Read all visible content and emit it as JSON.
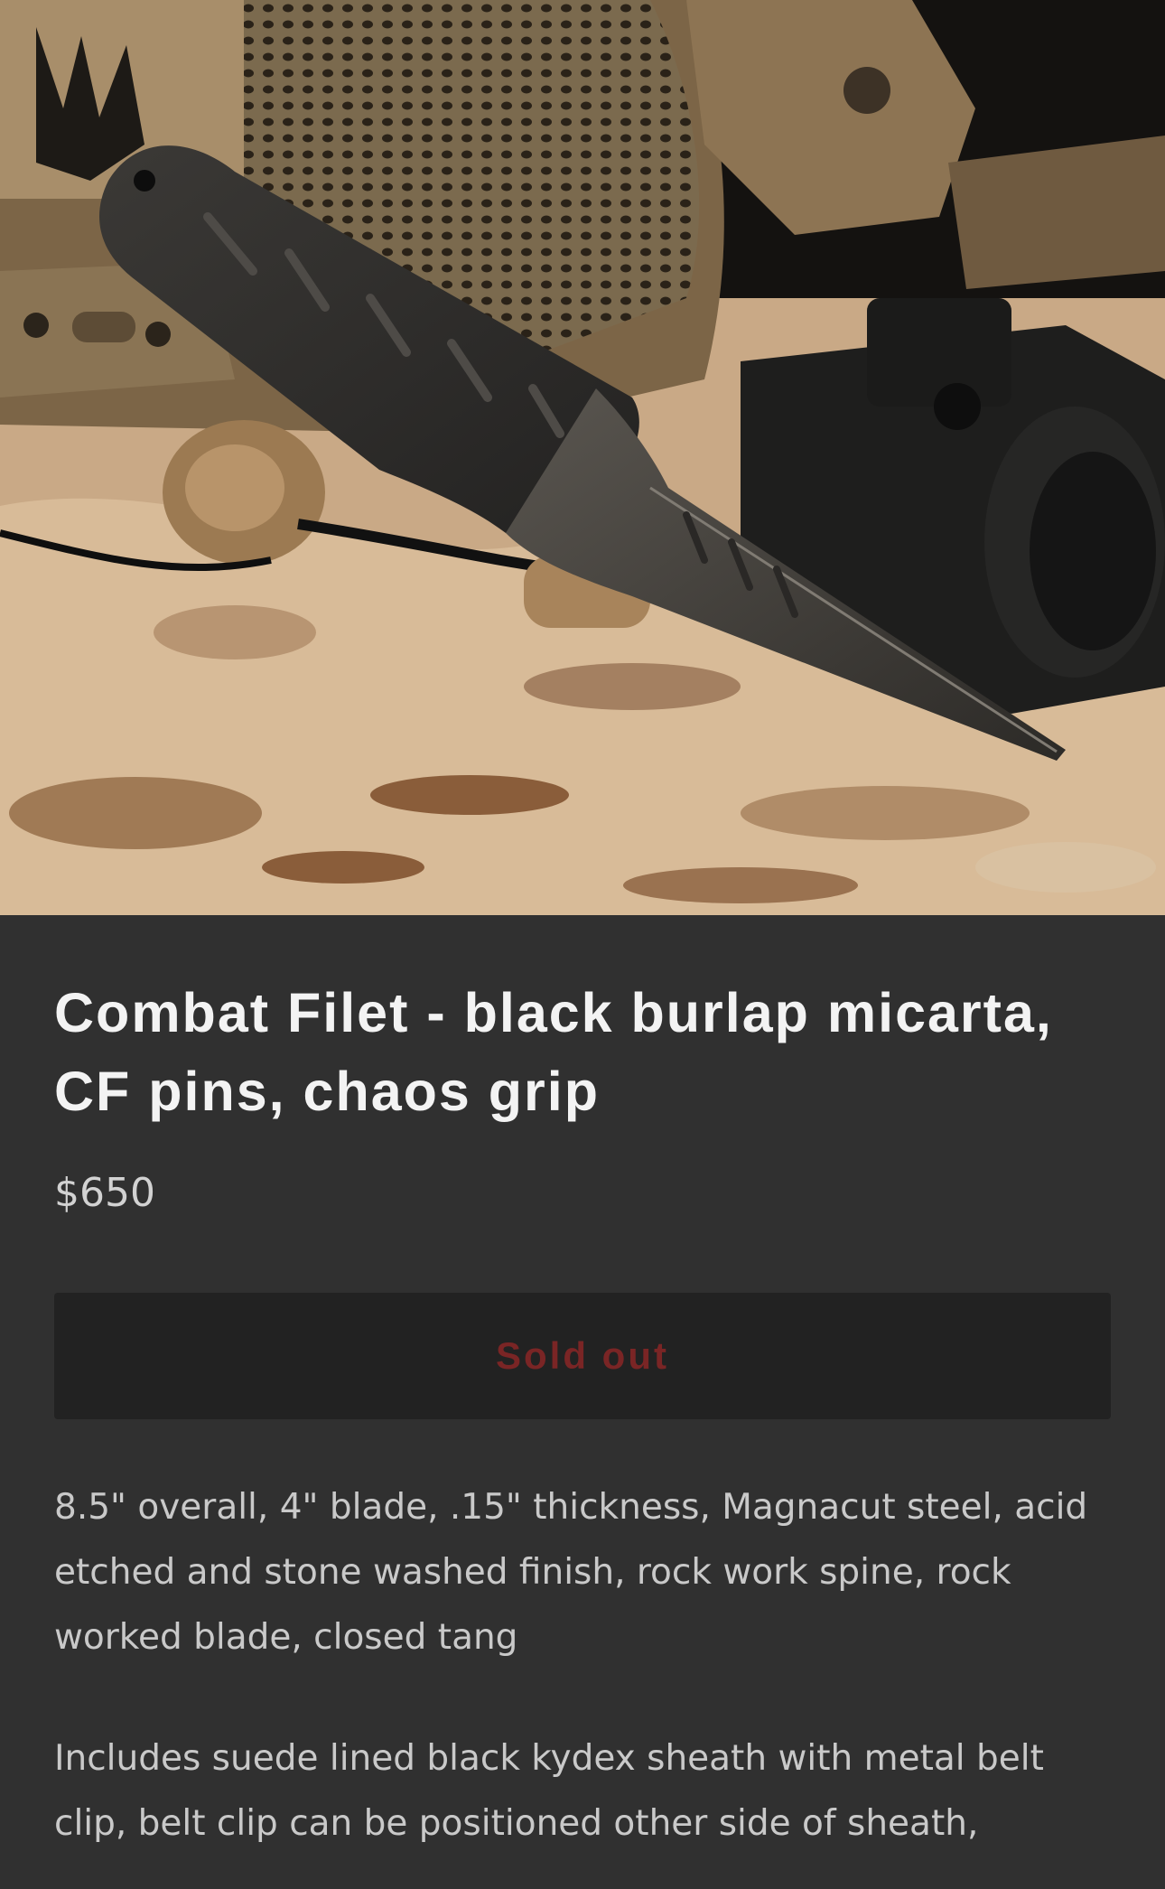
{
  "product": {
    "image_alt": "Combat Filet knife with black burlap micarta handle laid on tactical helmet and night vision gear over desert camo fabric",
    "title": "Combat Filet - black burlap micarta, CF pins, chaos grip",
    "price": "$650",
    "buy_button_label": "Sold out",
    "description": [
      "8.5\" overall, 4\" blade, .15\" thickness, Magnacut steel, acid etched and stone washed finish, rock work spine, rock worked blade, closed tang",
      "Includes suede lined black kydex sheath with metal belt clip, belt clip can be positioned other side of sheath,"
    ]
  },
  "colors": {
    "page_background": "#303030",
    "title_text": "#f3f3f3",
    "button_background": "#222222",
    "sold_out_text": "#7a2525"
  }
}
